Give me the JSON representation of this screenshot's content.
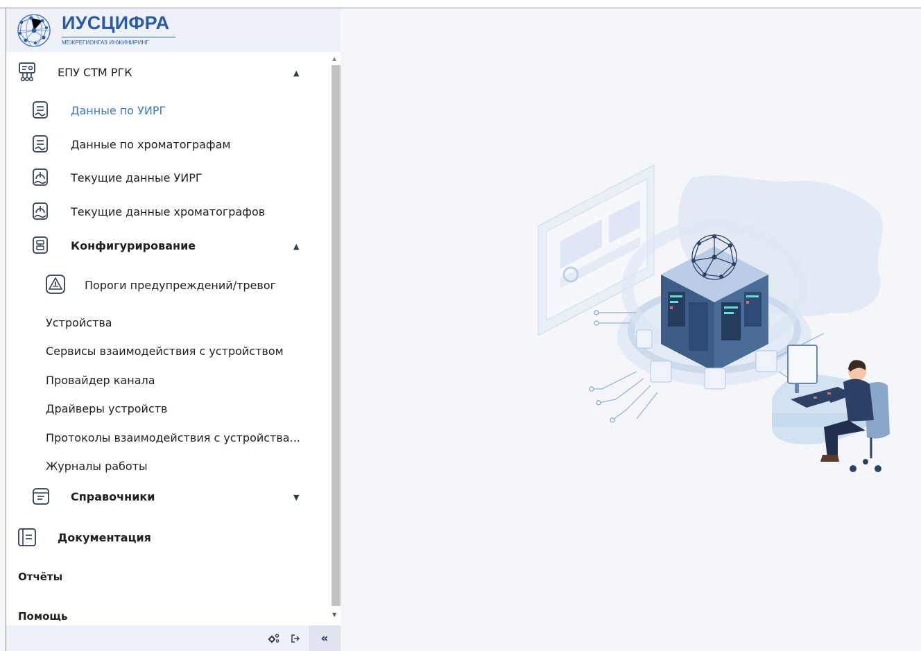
{
  "brand": {
    "title": "ИУСЦИФРА",
    "subtitle": "МЕЖРЕГИОНГАЗ ИНЖИНИРИНГ",
    "accent": "#2a5ba8"
  },
  "menu": {
    "epu": {
      "label": "ЕПУ СТМ РГК",
      "icon": "network-icon",
      "items": [
        {
          "label": "Данные по УИРГ",
          "icon": "chart-doc-icon",
          "active": true
        },
        {
          "label": "Данные по хроматографам",
          "icon": "chart-doc-icon"
        },
        {
          "label": "Текущие данные УИРГ",
          "icon": "gauge-icon"
        },
        {
          "label": "Текущие данные хроматографов",
          "icon": "gauge-icon"
        }
      ],
      "config": {
        "label": "Конфигурирование",
        "icon": "config-icon",
        "items": [
          {
            "label": "Пороги предупреждений/тревог",
            "icon": "warning-icon"
          },
          {
            "label": "Устройства"
          },
          {
            "label": "Сервисы взаимодействия с устройством"
          },
          {
            "label": "Провайдер канала"
          },
          {
            "label": "Драйверы устройств"
          },
          {
            "label": "Протоколы взаимодействия с устройства..."
          },
          {
            "label": "Журналы работы"
          }
        ]
      },
      "refs": {
        "label": "Справочники",
        "icon": "folder-icon"
      }
    },
    "docs": {
      "label": "Документация",
      "icon": "book-icon"
    },
    "reports": {
      "label": "Отчёты"
    },
    "help": {
      "label": "Помощь"
    }
  },
  "footer": {
    "settings_icon": "settings-icon",
    "logout_icon": "logout-icon",
    "collapse_label": "«"
  },
  "colors": {
    "active": "#3a79c4",
    "background": "#f4f6fa",
    "sidebar": "#ffffff"
  }
}
